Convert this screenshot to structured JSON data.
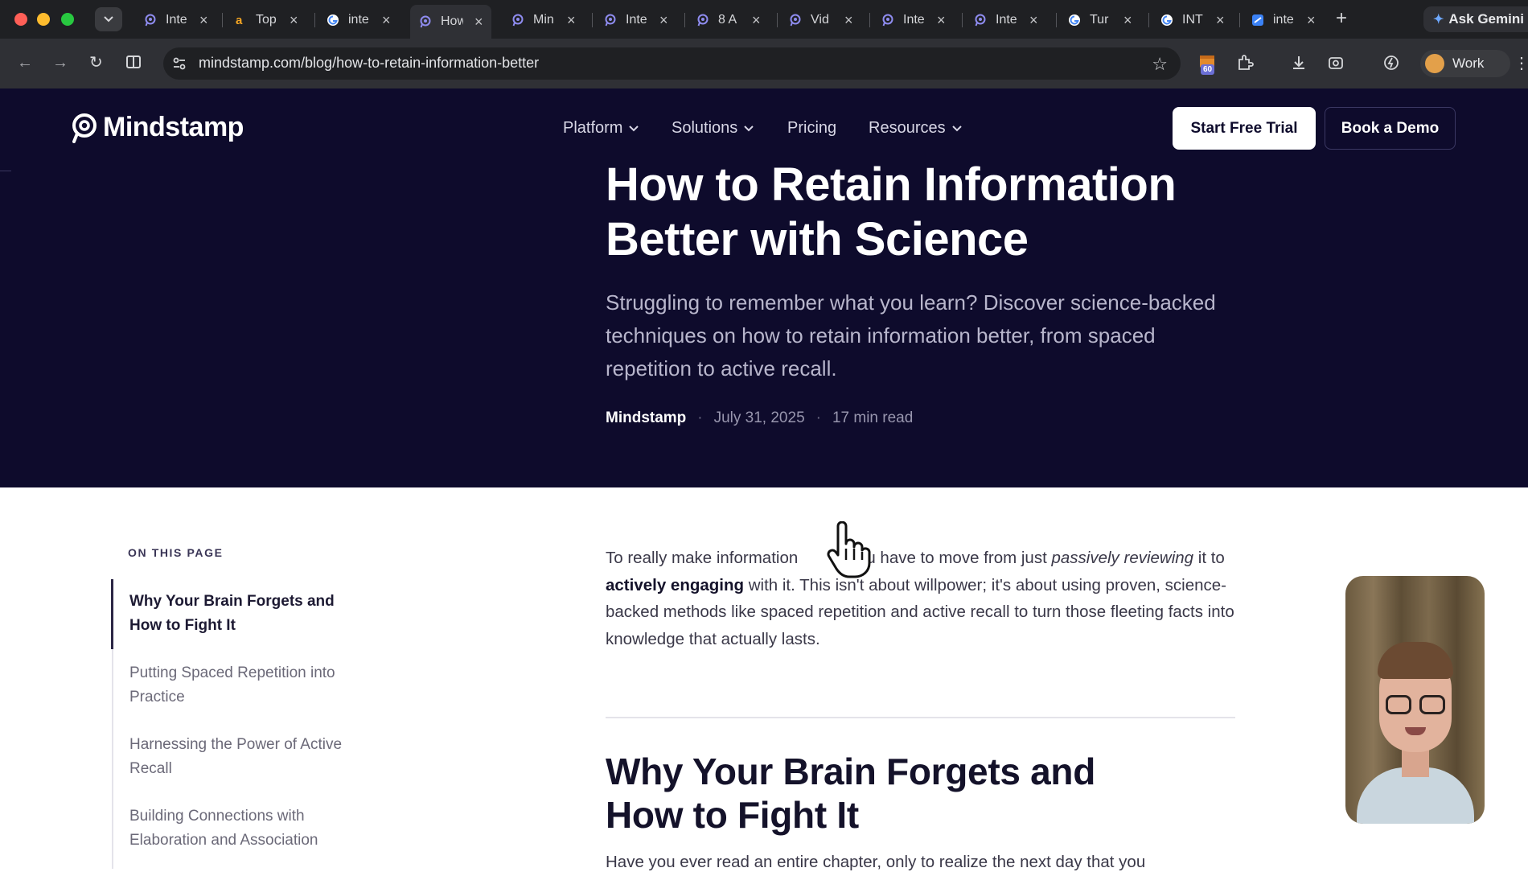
{
  "browser": {
    "tabs": [
      {
        "label": "Inte",
        "icon": "mindstamp-icon"
      },
      {
        "label": "Top",
        "icon": "amazon-icon"
      },
      {
        "label": "inte",
        "icon": "google-icon"
      },
      {
        "label": "How",
        "icon": "mindstamp-icon"
      },
      {
        "label": "Min",
        "icon": "mindstamp-icon"
      },
      {
        "label": "Inte",
        "icon": "mindstamp-icon"
      },
      {
        "label": "8 A",
        "icon": "mindstamp-icon"
      },
      {
        "label": "Vid",
        "icon": "mindstamp-icon"
      },
      {
        "label": "Inte",
        "icon": "mindstamp-icon"
      },
      {
        "label": "Inte",
        "icon": "mindstamp-icon"
      },
      {
        "label": "Tur",
        "icon": "google-icon"
      },
      {
        "label": "INT",
        "icon": "google-icon"
      },
      {
        "label": "inte",
        "icon": "app-icon"
      }
    ],
    "active_tab": 3,
    "ask_gemini": "Ask Gemini",
    "url": "mindstamp.com/blog/how-to-retain-information-better",
    "extension_badge": "60",
    "profile_name": "Work"
  },
  "site": {
    "logo_text": "Mindstamp",
    "nav": {
      "platform": "Platform",
      "solutions": "Solutions",
      "pricing": "Pricing",
      "resources": "Resources"
    },
    "cta_trial": "Start Free Trial",
    "cta_demo": "Book a Demo"
  },
  "hero": {
    "title": "How to Retain Information Better with Science",
    "subtitle": "Struggling to remember what you learn? Discover science-backed techniques on how to retain information better, from spaced repetition to active recall.",
    "author": "Mindstamp",
    "date": "July 31, 2025",
    "read_time": "17 min read",
    "separator": "·"
  },
  "toc": {
    "heading": "ON THIS PAGE",
    "items": [
      "Why Your Brain Forgets and How to Fight It",
      "Putting Spaced Repetition into Practice",
      "Harnessing the Power of Active Recall",
      "Building Connections with Elaboration and Association"
    ]
  },
  "article": {
    "intro_part1": "To really make information ",
    "intro_part2": " you have to move from just ",
    "intro_italic": "passively reviewing",
    "intro_part3": " it to ",
    "intro_bold": "actively engaging",
    "intro_part4": " with it. This isn't about willpower; it's about using proven, science-backed methods like spaced repetition and active recall to turn those fleeting facts into knowledge that actually lasts.",
    "h2": "Why Your Brain Forgets and How to Fight It",
    "para2_partial": "Have you ever read an entire chapter, only to realize the next day that you"
  },
  "colors": {
    "hero_bg": "#0e0b2c",
    "chrome_bg": "#1f2023",
    "toolbar_bg": "#2f3035"
  }
}
